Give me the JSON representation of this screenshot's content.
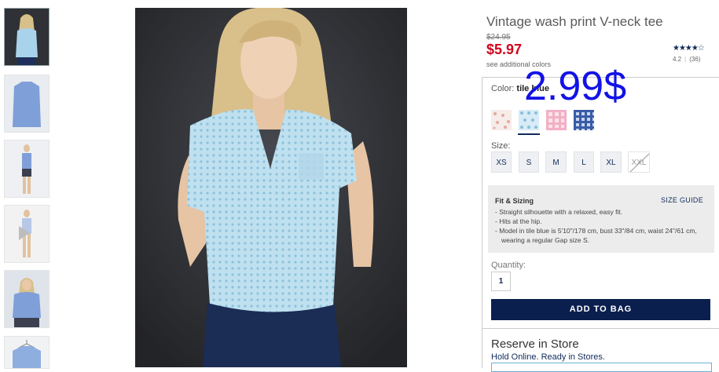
{
  "product": {
    "title": "Vintage wash print V-neck tee",
    "original_price": "$24.95",
    "price": "$5.97",
    "see_colors": "see additional colors",
    "stars": "★★★★☆",
    "rating": "4.2",
    "review_count": "(36)",
    "overlay_text": "2.99$"
  },
  "color": {
    "label": "Color:",
    "selected": "tile blue",
    "swatches": [
      {
        "name": "pink print",
        "hex": "#e8c9c4"
      },
      {
        "name": "tile blue",
        "hex": "#b9d8ea"
      },
      {
        "name": "pink gingham",
        "hex": "#f3b8cc"
      },
      {
        "name": "blue gingham",
        "hex": "#2a4fa0"
      }
    ]
  },
  "sizes": {
    "label": "Size:",
    "options": [
      "XS",
      "S",
      "M",
      "L",
      "XL",
      "XXL"
    ],
    "unavailable": [
      "XXL"
    ]
  },
  "fit": {
    "title": "Fit & Sizing",
    "guide_link": "SIZE GUIDE",
    "bullets": [
      "- Straight silhouette with a relaxed, easy fit.",
      "- Hits at the hip.",
      "- Model in tile blue is 5'10\"/178 cm, bust 33\"/84 cm, waist 24\"/61 cm, wearing a regular Gap size S."
    ]
  },
  "quantity": {
    "label": "Quantity:",
    "value": "1"
  },
  "actions": {
    "add_to_bag": "ADD TO BAG"
  },
  "reserve": {
    "title": "Reserve in Store",
    "subtitle": "Hold Online. Ready in Stores."
  },
  "colors": {
    "accent_navy": "#0b1f4f",
    "sale_red": "#d0021b",
    "overlay_blue": "#1212e6"
  }
}
